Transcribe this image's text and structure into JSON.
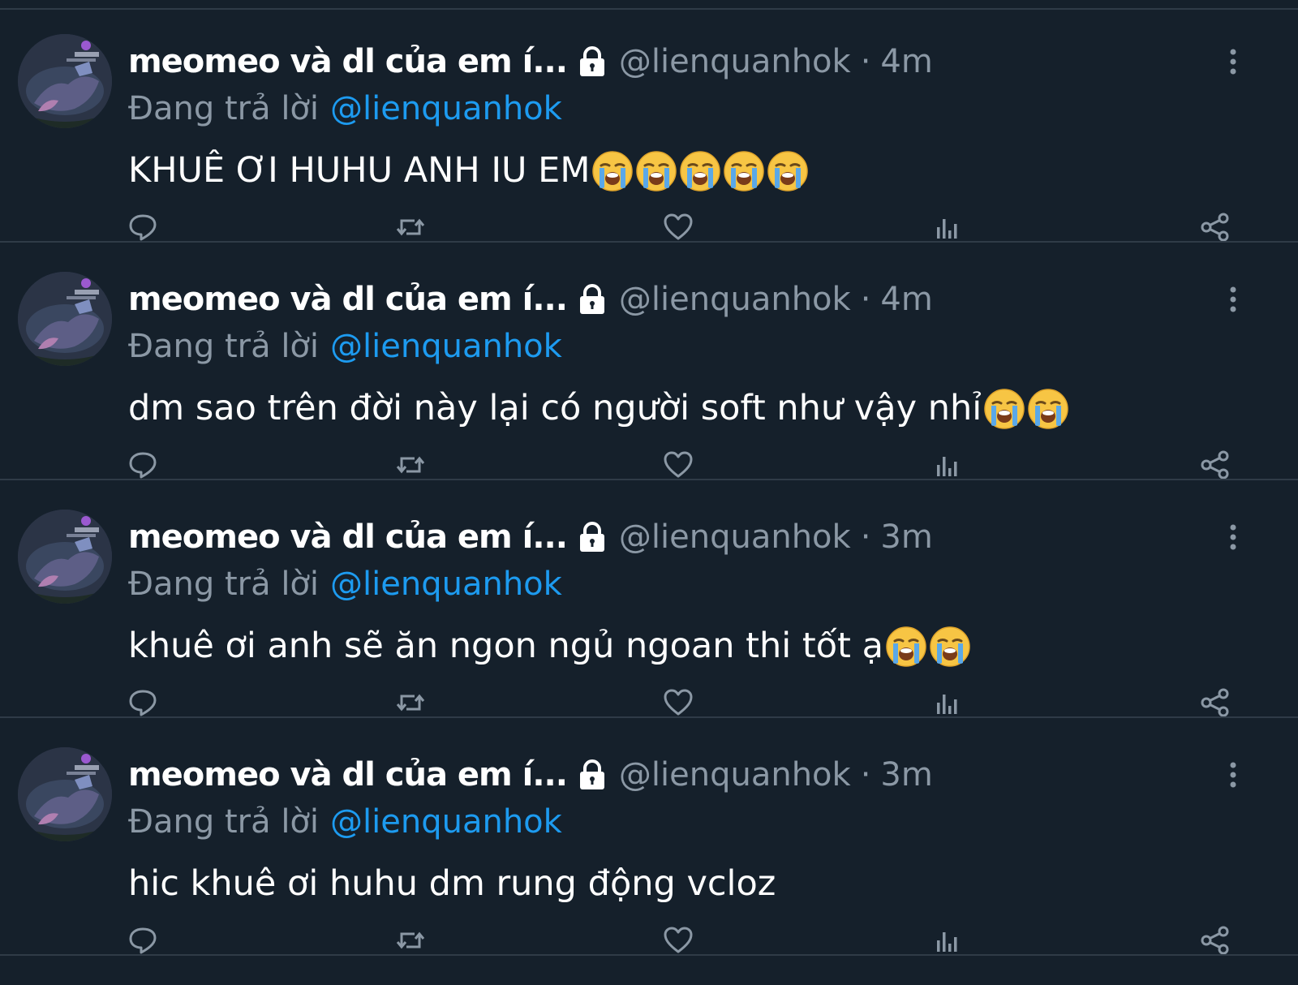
{
  "tweets": [
    {
      "name": "meomeo và dl của em í...",
      "handle": "@lienquanhok",
      "separator": "·",
      "time": "4m",
      "reply_prefix": "Đang trả lời",
      "reply_handle": "@lienquanhok",
      "text": "KHUÊ ƠI HUHU ANH IU EM",
      "emoji_count": 5,
      "emoji_icon": "loudly-crying-face-icon"
    },
    {
      "name": "meomeo và dl của em í...",
      "handle": "@lienquanhok",
      "separator": "·",
      "time": "4m",
      "reply_prefix": "Đang trả lời",
      "reply_handle": "@lienquanhok",
      "text": "dm sao trên đời này lại có người soft như vậy nhỉ",
      "emoji_count": 2,
      "emoji_icon": "loudly-crying-face-icon"
    },
    {
      "name": "meomeo và dl của em í...",
      "handle": "@lienquanhok",
      "separator": "·",
      "time": "3m",
      "reply_prefix": "Đang trả lời",
      "reply_handle": "@lienquanhok",
      "text": "khuê ơi anh sẽ ăn ngon ngủ ngoan thi tốt ạ",
      "emoji_count": 2,
      "emoji_icon": "loudly-crying-face-icon"
    },
    {
      "name": "meomeo và dl của em í...",
      "handle": "@lienquanhok",
      "separator": "·",
      "time": "3m",
      "reply_prefix": "Đang trả lời",
      "reply_handle": "@lienquanhok",
      "text": "hic khuê ơi huhu dm rung động vcloz",
      "emoji_count": 0,
      "emoji_icon": "loudly-crying-face-icon"
    }
  ],
  "icons": {
    "protected": "lock-icon",
    "more": "more-options-icon",
    "actions": [
      "reply-icon",
      "retweet-icon",
      "like-icon",
      "analytics-icon",
      "share-icon"
    ]
  },
  "colors": {
    "background": "#15202b",
    "divider": "#2f3b47",
    "secondary_text": "#8b98a5",
    "link": "#1d9bf0",
    "primary_text": "#ffffff"
  }
}
